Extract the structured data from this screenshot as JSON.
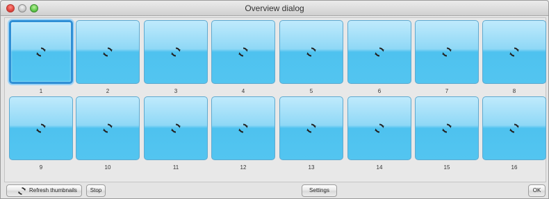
{
  "window": {
    "title": "Overview dialog"
  },
  "icons": {
    "tile_icon": "refresh-icon",
    "refresh_button_icon": "refresh-icon"
  },
  "colors": {
    "tile_top": "#bfeafc",
    "tile_bottom": "#53c5f0",
    "selection": "#2f8fd6"
  },
  "tiles": [
    {
      "label": "1",
      "selected": true
    },
    {
      "label": "2"
    },
    {
      "label": "3"
    },
    {
      "label": "4"
    },
    {
      "label": "5"
    },
    {
      "label": "6"
    },
    {
      "label": "7"
    },
    {
      "label": "8"
    },
    {
      "label": "9"
    },
    {
      "label": "10"
    },
    {
      "label": "11"
    },
    {
      "label": "12"
    },
    {
      "label": "13"
    },
    {
      "label": "14"
    },
    {
      "label": "15"
    },
    {
      "label": "16"
    }
  ],
  "buttons": {
    "refresh": "Refresh thumbnails",
    "stop": "Stop",
    "settings": "Settings",
    "ok": "OK"
  }
}
